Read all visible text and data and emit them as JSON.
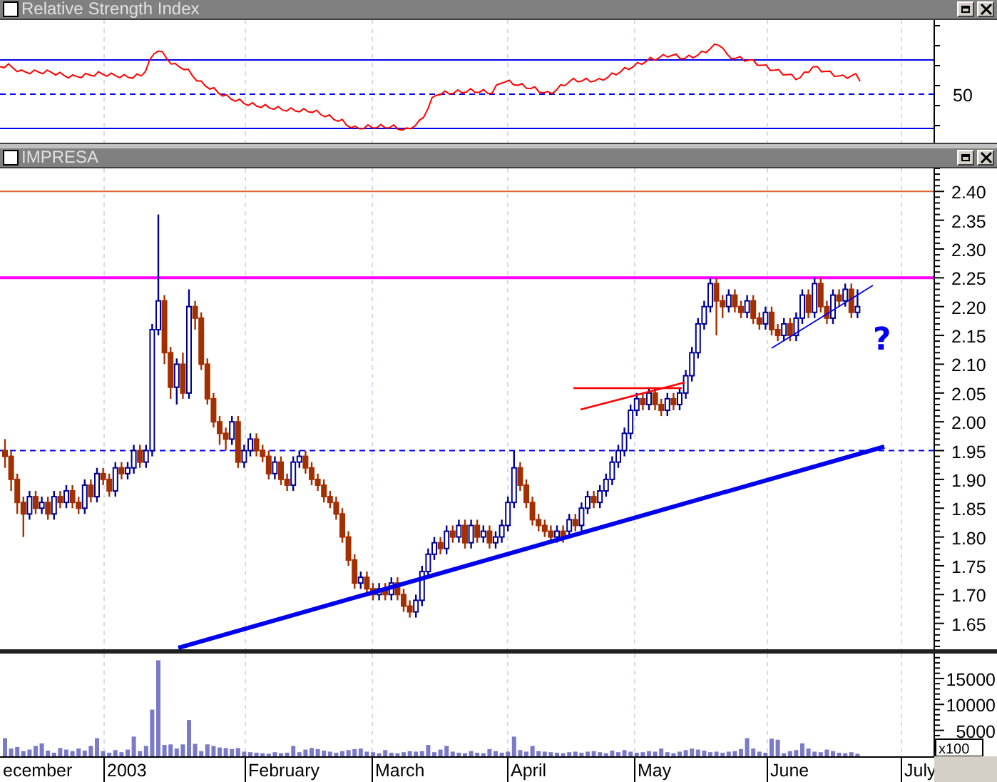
{
  "rsi_panel": {
    "title": "Relative Strength Index",
    "y_labels": [
      "50"
    ]
  },
  "price_panel": {
    "title": "IMPRESA",
    "chart_data": {
      "type": "candlestick",
      "ref_lines": [
        {
          "axis": "y",
          "value": 2.4
        },
        {
          "axis": "y",
          "value": 2.25
        },
        {
          "axis": "y",
          "value": 1.95
        }
      ],
      "annotations": [
        "?"
      ],
      "ohlc": [
        [
          1.95,
          1.97,
          1.92,
          1.94
        ],
        [
          1.94,
          1.95,
          1.88,
          1.9
        ],
        [
          1.9,
          1.91,
          1.84,
          1.86
        ],
        [
          1.86,
          1.87,
          1.8,
          1.84
        ],
        [
          1.84,
          1.88,
          1.83,
          1.87
        ],
        [
          1.87,
          1.88,
          1.84,
          1.85
        ],
        [
          1.85,
          1.87,
          1.84,
          1.86
        ],
        [
          1.86,
          1.87,
          1.83,
          1.84
        ],
        [
          1.84,
          1.88,
          1.83,
          1.87
        ],
        [
          1.87,
          1.88,
          1.85,
          1.86
        ],
        [
          1.86,
          1.89,
          1.85,
          1.88
        ],
        [
          1.88,
          1.89,
          1.85,
          1.86
        ],
        [
          1.86,
          1.87,
          1.84,
          1.85
        ],
        [
          1.85,
          1.9,
          1.84,
          1.89
        ],
        [
          1.89,
          1.9,
          1.86,
          1.87
        ],
        [
          1.87,
          1.92,
          1.86,
          1.91
        ],
        [
          1.91,
          1.92,
          1.89,
          1.9
        ],
        [
          1.9,
          1.91,
          1.87,
          1.88
        ],
        [
          1.88,
          1.93,
          1.87,
          1.92
        ],
        [
          1.92,
          1.93,
          1.9,
          1.91
        ],
        [
          1.91,
          1.93,
          1.9,
          1.92
        ],
        [
          1.92,
          1.96,
          1.91,
          1.95
        ],
        [
          1.95,
          1.96,
          1.92,
          1.93
        ],
        [
          1.93,
          1.96,
          1.92,
          1.95
        ],
        [
          1.95,
          2.17,
          1.94,
          2.16
        ],
        [
          2.16,
          2.36,
          2.15,
          2.21
        ],
        [
          2.21,
          2.22,
          2.1,
          2.12
        ],
        [
          2.12,
          2.13,
          2.04,
          2.06
        ],
        [
          2.06,
          2.11,
          2.03,
          2.1
        ],
        [
          2.1,
          2.12,
          2.04,
          2.05
        ],
        [
          2.05,
          2.23,
          2.04,
          2.2
        ],
        [
          2.2,
          2.21,
          2.16,
          2.18
        ],
        [
          2.18,
          2.19,
          2.09,
          2.1
        ],
        [
          2.1,
          2.11,
          2.03,
          2.04
        ],
        [
          2.04,
          2.05,
          1.99,
          2.0
        ],
        [
          2.0,
          2.01,
          1.96,
          1.98
        ],
        [
          1.98,
          1.99,
          1.95,
          1.97
        ],
        [
          1.97,
          2.01,
          1.96,
          2.0
        ],
        [
          2.0,
          2.01,
          1.92,
          1.93
        ],
        [
          1.93,
          1.96,
          1.92,
          1.95
        ],
        [
          1.95,
          1.98,
          1.94,
          1.97
        ],
        [
          1.97,
          1.98,
          1.94,
          1.95
        ],
        [
          1.95,
          1.96,
          1.93,
          1.94
        ],
        [
          1.94,
          1.95,
          1.9,
          1.91
        ],
        [
          1.91,
          1.94,
          1.9,
          1.93
        ],
        [
          1.93,
          1.94,
          1.89,
          1.9
        ],
        [
          1.9,
          1.91,
          1.88,
          1.89
        ],
        [
          1.89,
          1.94,
          1.88,
          1.93
        ],
        [
          1.93,
          1.95,
          1.92,
          1.94
        ],
        [
          1.94,
          1.95,
          1.91,
          1.92
        ],
        [
          1.92,
          1.93,
          1.89,
          1.9
        ],
        [
          1.9,
          1.91,
          1.88,
          1.89
        ],
        [
          1.89,
          1.9,
          1.86,
          1.87
        ],
        [
          1.87,
          1.88,
          1.85,
          1.86
        ],
        [
          1.86,
          1.87,
          1.83,
          1.84
        ],
        [
          1.84,
          1.85,
          1.79,
          1.8
        ],
        [
          1.8,
          1.81,
          1.75,
          1.76
        ],
        [
          1.76,
          1.77,
          1.71,
          1.72
        ],
        [
          1.72,
          1.74,
          1.71,
          1.73
        ],
        [
          1.73,
          1.74,
          1.7,
          1.71
        ],
        [
          1.71,
          1.72,
          1.69,
          1.7
        ],
        [
          1.7,
          1.72,
          1.69,
          1.71
        ],
        [
          1.71,
          1.72,
          1.69,
          1.7
        ],
        [
          1.7,
          1.73,
          1.69,
          1.72
        ],
        [
          1.72,
          1.73,
          1.69,
          1.7
        ],
        [
          1.7,
          1.71,
          1.67,
          1.68
        ],
        [
          1.68,
          1.69,
          1.66,
          1.67
        ],
        [
          1.67,
          1.7,
          1.66,
          1.69
        ],
        [
          1.69,
          1.75,
          1.68,
          1.74
        ],
        [
          1.74,
          1.78,
          1.73,
          1.77
        ],
        [
          1.77,
          1.8,
          1.76,
          1.79
        ],
        [
          1.79,
          1.8,
          1.77,
          1.78
        ],
        [
          1.78,
          1.82,
          1.77,
          1.81
        ],
        [
          1.81,
          1.82,
          1.79,
          1.8
        ],
        [
          1.8,
          1.83,
          1.79,
          1.82
        ],
        [
          1.82,
          1.83,
          1.78,
          1.79
        ],
        [
          1.79,
          1.83,
          1.78,
          1.82
        ],
        [
          1.82,
          1.83,
          1.79,
          1.8
        ],
        [
          1.8,
          1.82,
          1.79,
          1.81
        ],
        [
          1.81,
          1.82,
          1.78,
          1.79
        ],
        [
          1.79,
          1.81,
          1.78,
          1.8
        ],
        [
          1.8,
          1.83,
          1.79,
          1.82
        ],
        [
          1.82,
          1.87,
          1.81,
          1.86
        ],
        [
          1.86,
          1.95,
          1.85,
          1.92
        ],
        [
          1.92,
          1.93,
          1.88,
          1.89
        ],
        [
          1.89,
          1.9,
          1.85,
          1.86
        ],
        [
          1.86,
          1.87,
          1.82,
          1.83
        ],
        [
          1.83,
          1.84,
          1.81,
          1.82
        ],
        [
          1.82,
          1.83,
          1.8,
          1.81
        ],
        [
          1.81,
          1.82,
          1.79,
          1.8
        ],
        [
          1.8,
          1.82,
          1.79,
          1.81
        ],
        [
          1.81,
          1.82,
          1.79,
          1.8
        ],
        [
          1.81,
          1.84,
          1.8,
          1.83
        ],
        [
          1.83,
          1.84,
          1.81,
          1.82
        ],
        [
          1.82,
          1.86,
          1.81,
          1.85
        ],
        [
          1.85,
          1.88,
          1.84,
          1.87
        ],
        [
          1.87,
          1.88,
          1.85,
          1.86
        ],
        [
          1.86,
          1.89,
          1.85,
          1.88
        ],
        [
          1.88,
          1.91,
          1.87,
          1.9
        ],
        [
          1.9,
          1.94,
          1.89,
          1.93
        ],
        [
          1.93,
          1.96,
          1.92,
          1.95
        ],
        [
          1.95,
          1.99,
          1.94,
          1.98
        ],
        [
          1.98,
          2.03,
          1.97,
          2.02
        ],
        [
          2.02,
          2.05,
          2.01,
          2.04
        ],
        [
          2.04,
          2.05,
          2.02,
          2.03
        ],
        [
          2.03,
          2.06,
          2.02,
          2.05
        ],
        [
          2.05,
          2.06,
          2.02,
          2.03
        ],
        [
          2.03,
          2.04,
          2.01,
          2.02
        ],
        [
          2.02,
          2.05,
          2.01,
          2.04
        ],
        [
          2.04,
          2.05,
          2.02,
          2.03
        ],
        [
          2.03,
          2.06,
          2.02,
          2.05
        ],
        [
          2.05,
          2.09,
          2.04,
          2.08
        ],
        [
          2.08,
          2.13,
          2.07,
          2.12
        ],
        [
          2.12,
          2.18,
          2.11,
          2.17
        ],
        [
          2.17,
          2.21,
          2.16,
          2.2
        ],
        [
          2.2,
          2.25,
          2.19,
          2.24
        ],
        [
          2.24,
          2.25,
          2.15,
          2.21
        ],
        [
          2.21,
          2.22,
          2.18,
          2.2
        ],
        [
          2.2,
          2.23,
          2.19,
          2.22
        ],
        [
          2.22,
          2.23,
          2.19,
          2.2
        ],
        [
          2.2,
          2.21,
          2.18,
          2.19
        ],
        [
          2.19,
          2.22,
          2.18,
          2.21
        ],
        [
          2.21,
          2.22,
          2.17,
          2.18
        ],
        [
          2.18,
          2.19,
          2.16,
          2.17
        ],
        [
          2.17,
          2.2,
          2.16,
          2.19
        ],
        [
          2.19,
          2.2,
          2.15,
          2.16
        ],
        [
          2.16,
          2.17,
          2.14,
          2.15
        ],
        [
          2.15,
          2.18,
          2.14,
          2.17
        ],
        [
          2.17,
          2.18,
          2.14,
          2.15
        ],
        [
          2.15,
          2.19,
          2.14,
          2.18
        ],
        [
          2.18,
          2.23,
          2.17,
          2.22
        ],
        [
          2.22,
          2.23,
          2.18,
          2.19
        ],
        [
          2.19,
          2.25,
          2.18,
          2.24
        ],
        [
          2.24,
          2.25,
          2.19,
          2.2
        ],
        [
          2.2,
          2.21,
          2.17,
          2.18
        ],
        [
          2.18,
          2.23,
          2.17,
          2.22
        ],
        [
          2.22,
          2.23,
          2.2,
          2.21
        ],
        [
          2.21,
          2.24,
          2.2,
          2.23
        ],
        [
          2.23,
          2.24,
          2.18,
          2.19
        ],
        [
          2.19,
          2.23,
          2.18,
          2.2
        ]
      ],
      "ylim": [
        1.605,
        2.44
      ],
      "yticks": [
        {
          "value": 2.4,
          "label": "2.40"
        },
        {
          "value": 2.35,
          "label": "2.35"
        },
        {
          "value": 2.3,
          "label": "2.30"
        },
        {
          "value": 2.25,
          "label": "2.25"
        },
        {
          "value": 2.2,
          "label": "2.20"
        },
        {
          "value": 2.15,
          "label": "2.15"
        },
        {
          "value": 2.1,
          "label": "2.10"
        },
        {
          "value": 2.05,
          "label": "2.05"
        },
        {
          "value": 2.0,
          "label": "2.00"
        },
        {
          "value": 1.95,
          "label": "1.95"
        },
        {
          "value": 1.9,
          "label": "1.90"
        },
        {
          "value": 1.85,
          "label": "1.85"
        },
        {
          "value": 1.8,
          "label": "1.80"
        },
        {
          "value": 1.75,
          "label": "1.75"
        },
        {
          "value": 1.7,
          "label": "1.70"
        },
        {
          "value": 1.65,
          "label": "1.65"
        }
      ]
    }
  },
  "volume_panel": {
    "multiplier": "x100",
    "chart_data": {
      "type": "bar",
      "values": [
        3500,
        1500,
        1800,
        1000,
        1300,
        2000,
        2500,
        1100,
        700,
        1600,
        1300,
        1000,
        1500,
        1100,
        2000,
        3500,
        1000,
        700,
        1200,
        800,
        1300,
        3800,
        1000,
        2000,
        9000,
        18500,
        2200,
        2300,
        1500,
        2300,
        7000,
        2400,
        1000,
        2300,
        2000,
        1700,
        1600,
        1400,
        1600,
        900,
        800,
        700,
        600,
        500,
        800,
        600,
        700,
        2000,
        800,
        1300,
        1600,
        1400,
        1100,
        900,
        700,
        1000,
        1200,
        1400,
        1500,
        900,
        800,
        600,
        1200,
        700,
        600,
        800,
        1000,
        900,
        1000,
        2200,
        800,
        1300,
        2000,
        900,
        700,
        600,
        1000,
        700,
        600,
        1400,
        1000,
        700,
        900,
        3800,
        1200,
        900,
        2000,
        1000,
        900,
        800,
        700,
        600,
        800,
        900,
        700,
        900,
        1000,
        800,
        600,
        1100,
        800,
        1200,
        900,
        700,
        800,
        1000,
        900,
        1500,
        800,
        600,
        900,
        1200,
        1500,
        1300,
        1100,
        800,
        900,
        700,
        900,
        1000,
        1400,
        3500,
        1500,
        900,
        700,
        3400,
        3200,
        600,
        1000,
        1200,
        2500,
        1500,
        900,
        800,
        1300,
        1000,
        700,
        600,
        800,
        500
      ],
      "ylim": [
        0,
        19800
      ],
      "yticks": [
        15000,
        10000,
        5000
      ]
    }
  },
  "date_axis": {
    "labels": [
      "ecember",
      "2003",
      "February",
      "March",
      "April",
      "May",
      "June",
      "July"
    ]
  }
}
